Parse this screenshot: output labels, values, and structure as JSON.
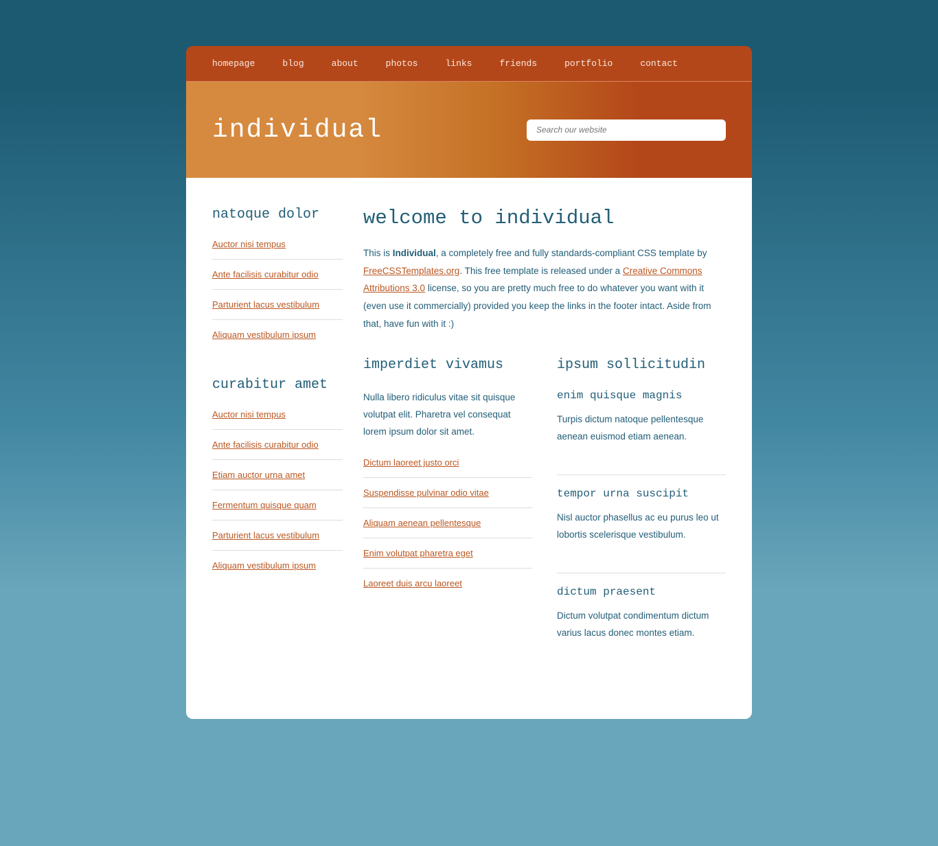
{
  "nav": {
    "items": [
      "homepage",
      "blog",
      "about",
      "photos",
      "links",
      "friends",
      "portfolio",
      "contact"
    ]
  },
  "header": {
    "logo": "individual",
    "search_placeholder": "Search our website"
  },
  "sidebar": {
    "group1": {
      "title": "natoque dolor",
      "links": [
        "Auctor nisi tempus",
        "Ante facilisis curabitur odio",
        "Parturient lacus vestibulum",
        "Aliquam vestibulum ipsum"
      ]
    },
    "group2": {
      "title": "curabitur amet",
      "links": [
        "Auctor nisi tempus",
        "Ante facilisis curabitur odio",
        "Etiam auctor urna amet",
        "Fermentum quisque quam",
        "Parturient lacus vestibulum",
        "Aliquam vestibulum ipsum"
      ]
    }
  },
  "main": {
    "title": "welcome to individual",
    "intro": {
      "pre": "This is ",
      "bold": "Individual",
      "mid1": ", a completely free and fully standards-compliant CSS template by ",
      "link1": "FreeCSSTemplates.org",
      "mid2": ". This free template is released under a ",
      "link2": "Creative Commons Attributions 3.0",
      "post": " license, so you are pretty much free to do whatever you want with it (even use it commercially) provided you keep the links in the footer intact. Aside from that, have fun with it :)"
    },
    "col1": {
      "title": "imperdiet vivamus",
      "text": "Nulla libero ridiculus vitae sit quisque volutpat elit. Pharetra vel consequat lorem ipsum dolor sit amet.",
      "links": [
        "Dictum laoreet justo orci",
        "Suspendisse pulvinar odio vitae",
        "Aliquam aenean pellentesque",
        "Enim volutpat pharetra eget",
        "Laoreet duis arcu laoreet"
      ]
    },
    "col2": {
      "title": "ipsum sollicitudin",
      "blocks": [
        {
          "h": "enim quisque magnis",
          "p": "Turpis dictum natoque pellentesque aenean euismod etiam aenean."
        },
        {
          "h": "tempor urna suscipit",
          "p": "Nisl auctor phasellus ac eu purus leo ut lobortis scelerisque vestibulum."
        },
        {
          "h": "dictum praesent",
          "p": "Dictum volutpat condimentum dictum varius lacus donec montes etiam."
        }
      ]
    }
  }
}
